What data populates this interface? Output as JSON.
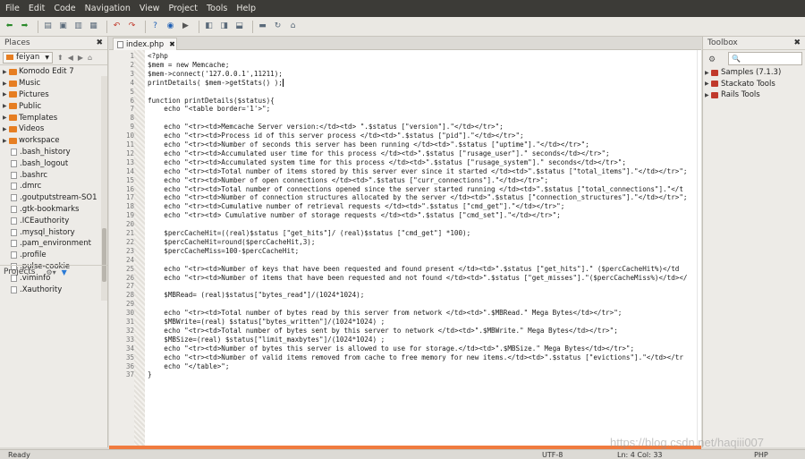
{
  "menu": [
    "File",
    "Edit",
    "Code",
    "Navigation",
    "View",
    "Project",
    "Tools",
    "Help"
  ],
  "toolbar_icons": [
    "back-icon",
    "forward-icon",
    "new-file-icon",
    "open-file-icon",
    "save-icon",
    "save-all-icon",
    "undo-icon",
    "redo-icon",
    "help-icon",
    "globe-icon",
    "run-icon",
    "pane-left-icon",
    "pane-right-icon",
    "pane-bottom-icon",
    "paste-icon",
    "refresh-icon",
    "home-icon"
  ],
  "places": {
    "title": "Places",
    "folder": "feiyan",
    "items": [
      {
        "label": "Komodo Edit 7",
        "type": "folder",
        "arrow": true
      },
      {
        "label": "Music",
        "type": "folder",
        "arrow": true
      },
      {
        "label": "Pictures",
        "type": "folder",
        "arrow": true
      },
      {
        "label": "Public",
        "type": "folder",
        "arrow": true
      },
      {
        "label": "Templates",
        "type": "folder",
        "arrow": true
      },
      {
        "label": "Videos",
        "type": "folder",
        "arrow": true
      },
      {
        "label": "workspace",
        "type": "folder",
        "arrow": true
      },
      {
        "label": ".bash_history",
        "type": "file"
      },
      {
        "label": ".bash_logout",
        "type": "file"
      },
      {
        "label": ".bashrc",
        "type": "file"
      },
      {
        "label": ".dmrc",
        "type": "file"
      },
      {
        "label": ".goutputstream-SO1",
        "type": "file"
      },
      {
        "label": ".gtk-bookmarks",
        "type": "file"
      },
      {
        "label": ".ICEauthority",
        "type": "file"
      },
      {
        "label": ".mysql_history",
        "type": "file"
      },
      {
        "label": ".pam_environment",
        "type": "file"
      },
      {
        "label": ".profile",
        "type": "file"
      },
      {
        "label": ".pulse-cookie",
        "type": "file"
      },
      {
        "label": ".viminfo",
        "type": "file"
      },
      {
        "label": ".Xauthority",
        "type": "file"
      }
    ]
  },
  "projects": {
    "title": "Projects"
  },
  "editor": {
    "tab": "index.php",
    "lines": [
      "<?php",
      "$mem = new Memcache;",
      "$mem->connect('127.0.0.1',11211);",
      "printDetails( $mem->getStats() );",
      "",
      "function printDetails($status){",
      "    echo \"<table border='1'>\";",
      "",
      "    echo \"<tr><td>Memcache Server version:</td><td> \".$status [\"version\"].\"</td></tr>\";",
      "    echo \"<tr><td>Process id of this server process </td><td>\".$status [\"pid\"].\"</td></tr>\";",
      "    echo \"<tr><td>Number of seconds this server has been running </td><td>\".$status [\"uptime\"].\"</td></tr>\";",
      "    echo \"<tr><td>Accumulated user time for this process </td><td>\".$status [\"rusage_user\"].\" seconds</td></tr>\";",
      "    echo \"<tr><td>Accumulated system time for this process </td><td>\".$status [\"rusage_system\"].\" seconds</td></tr>\";",
      "    echo \"<tr><td>Total number of items stored by this server ever since it started </td><td>\".$status [\"total_items\"].\"</td></tr>\";",
      "    echo \"<tr><td>Number of open connections </td><td>\".$status [\"curr_connections\"].\"</td></tr>\";",
      "    echo \"<tr><td>Total number of connections opened since the server started running </td><td>\".$status [\"total_connections\"].\"</t",
      "    echo \"<tr><td>Number of connection structures allocated by the server </td><td>\".$status [\"connection_structures\"].\"</td></tr>\";",
      "    echo \"<tr><td>Cumulative number of retrieval requests </td><td>\".$status [\"cmd_get\"].\"</td></tr>\";",
      "    echo \"<tr><td> Cumulative number of storage requests </td><td>\".$status [\"cmd_set\"].\"</td></tr>\";",
      "",
      "    $percCacheHit=((real)$status [\"get_hits\"]/ (real)$status [\"cmd_get\"] *100);",
      "    $percCacheHit=round($percCacheHit,3);",
      "    $percCacheMiss=100-$percCacheHit;",
      "",
      "    echo \"<tr><td>Number of keys that have been requested and found present </td><td>\".$status [\"get_hits\"].\" ($percCacheHit%)</td",
      "    echo \"<tr><td>Number of items that have been requested and not found </td><td>\".$status [\"get_misses\"].\"($percCacheMiss%)</td></",
      "",
      "    $MBRead= (real)$status[\"bytes_read\"]/(1024*1024);",
      "",
      "    echo \"<tr><td>Total number of bytes read by this server from network </td><td>\".$MBRead.\" Mega Bytes</td></tr>\";",
      "    $MBWrite=(real) $status[\"bytes_written\"]/(1024*1024) ;",
      "    echo \"<tr><td>Total number of bytes sent by this server to network </td><td>\".$MBWrite.\" Mega Bytes</td></tr>\";",
      "    $MBSize=(real) $status[\"limit_maxbytes\"]/(1024*1024) ;",
      "    echo \"<tr><td>Number of bytes this server is allowed to use for storage.</td><td>\".$MBSize.\" Mega Bytes</td></tr>\";",
      "    echo \"<tr><td>Number of valid items removed from cache to free memory for new items.</td><td>\".$status [\"evictions\"].\"</td></tr",
      "    echo \"</table>\";",
      "}"
    ]
  },
  "toolbox": {
    "title": "Toolbox",
    "items": [
      "Samples (7.1.3)",
      "Stackato Tools",
      "Rails Tools"
    ]
  },
  "status": {
    "ready": "Ready",
    "encoding": "UTF-8",
    "position": "Ln: 4 Col: 33",
    "language": "PHP"
  },
  "watermark": "https://blog.csdn.net/haqiii007"
}
